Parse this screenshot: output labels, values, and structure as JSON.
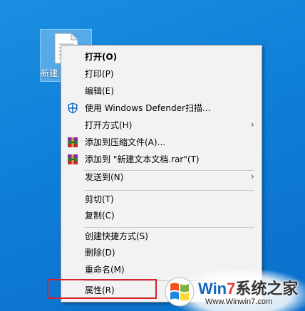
{
  "desktop": {
    "file_icon_label": "新建"
  },
  "menu": {
    "items": [
      {
        "label": "打开(O)",
        "bold": true
      },
      {
        "label": "打印(P)"
      },
      {
        "label": "编辑(E)"
      },
      {
        "label": "使用 Windows Defender扫描...",
        "icon": "windows-defender-shield-icon"
      },
      {
        "label": "打开方式(H)",
        "submenu": true
      },
      {
        "label": "添加到压缩文件(A)...",
        "icon": "winrar-icon"
      },
      {
        "label": "添加到 \"新建文本文档.rar\"(T)",
        "icon": "winrar-icon"
      },
      {
        "label": "发送到(N)",
        "submenu": true
      },
      {
        "label": "剪切(T)"
      },
      {
        "label": "复制(C)"
      },
      {
        "label": "创建快捷方式(S)"
      },
      {
        "label": "删除(D)"
      },
      {
        "label": "重命名(M)"
      },
      {
        "label": "属性(R)"
      }
    ],
    "submenu_arrow": "›"
  },
  "watermark": {
    "brand_prefix": "Win",
    "brand_number": "7",
    "brand_suffix": "系统之家",
    "url": "Www.Winwin7.com"
  },
  "colors": {
    "desktop_blue": "#0f7ed8",
    "menu_bg": "#f2f2f2",
    "highlight_red": "#d9202c"
  }
}
